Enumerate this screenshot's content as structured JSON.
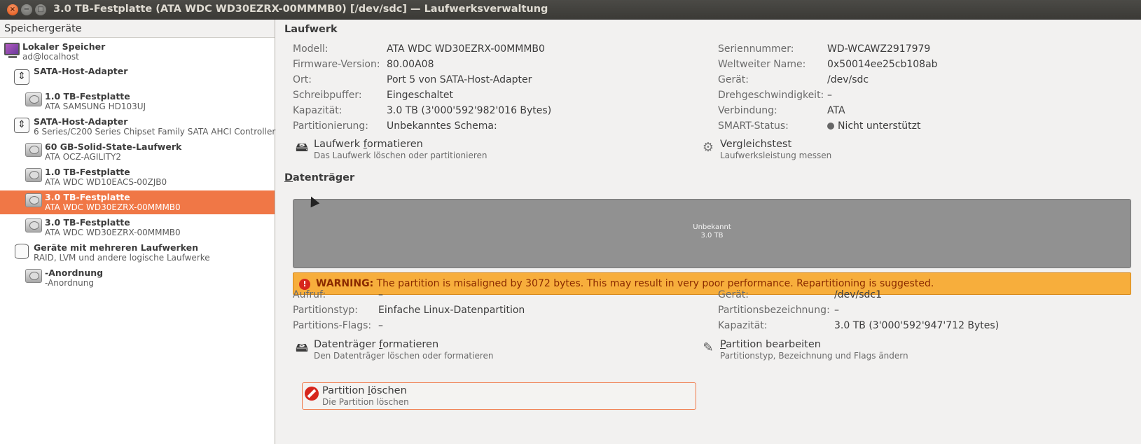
{
  "window": {
    "title": "3.0 TB-Festplatte (ATA WDC WD30EZRX-00MMMB0) [/dev/sdc] — Laufwerksverwaltung",
    "close_glyph": "×",
    "min_glyph": "−",
    "max_glyph": "□"
  },
  "sidebar": {
    "header": "Speichergeräte",
    "items": [
      {
        "title": "Lokaler Speicher",
        "sub": "ad@localhost"
      },
      {
        "title": "SATA-Host-Adapter",
        "sub": ""
      },
      {
        "title": "1.0 TB-Festplatte",
        "sub": "ATA SAMSUNG HD103UJ"
      },
      {
        "title": "SATA-Host-Adapter",
        "sub": "6 Series/C200 Series Chipset Family SATA AHCI Controller"
      },
      {
        "title": "60 GB-Solid-State-Laufwerk",
        "sub": "ATA OCZ-AGILITY2"
      },
      {
        "title": "1.0 TB-Festplatte",
        "sub": "ATA WDC WD10EACS-00ZJB0"
      },
      {
        "title": "3.0 TB-Festplatte",
        "sub": "ATA WDC WD30EZRX-00MMMB0"
      },
      {
        "title": "3.0 TB-Festplatte",
        "sub": "ATA WDC WD30EZRX-00MMMB0"
      },
      {
        "title": "Geräte mit mehreren Laufwerken",
        "sub": "RAID, LVM und andere logische Laufwerke"
      },
      {
        "title": "-Anordnung",
        "sub": "-Anordnung"
      }
    ]
  },
  "drive": {
    "header": "Laufwerk",
    "left": [
      {
        "label": "Modell:",
        "value": "ATA WDC WD30EZRX-00MMMB0"
      },
      {
        "label": "Firmware-Version:",
        "value": "80.00A08"
      },
      {
        "label": "Ort:",
        "value": "Port 5 von SATA-Host-Adapter"
      },
      {
        "label": "Schreibpuffer:",
        "value": "Eingeschaltet"
      },
      {
        "label": "Kapazität:",
        "value": "3.0 TB (3'000'592'982'016 Bytes)"
      },
      {
        "label": "Partitionierung:",
        "value": "Unbekanntes Schema:"
      }
    ],
    "right": [
      {
        "label": "Seriennummer:",
        "value": "WD-WCAWZ2917979"
      },
      {
        "label": "Weltweiter Name:",
        "value": "0x50014ee25cb108ab"
      },
      {
        "label": "Gerät:",
        "value": "/dev/sdc"
      },
      {
        "label": "Drehgeschwindigkeit:",
        "value": "–"
      },
      {
        "label": "Verbindung:",
        "value": "ATA"
      },
      {
        "label": "SMART-Status:",
        "value": "Nicht unterstützt"
      }
    ],
    "format_action": {
      "title_pre": "Laufwerk ",
      "title_u": "f",
      "title_post": "ormatieren",
      "sub": "Das Laufwerk löschen oder partitionieren"
    },
    "benchmark_action": {
      "title": "Vergleichstest",
      "sub": "Laufwerksleistung messen"
    }
  },
  "volumes": {
    "header_u": "D",
    "header_rest": "atenträger",
    "bar_name": "Unbekannt",
    "bar_size": "3.0 TB",
    "warning_prefix": "WARNING:",
    "warning_text": " The partition is misaligned by 3072 bytes. This may result in very poor performance. Repartitioning is suggested.",
    "left": [
      {
        "label": "Aufruf:",
        "value": "–"
      },
      {
        "label": "Partitionstyp:",
        "value": "Einfache Linux-Datenpartition"
      },
      {
        "label": "Partitions-Flags:",
        "value": "–"
      }
    ],
    "right": [
      {
        "label": "Gerät:",
        "value": "/dev/sdc1"
      },
      {
        "label": "Partitionsbezeichnung:",
        "value": "–"
      },
      {
        "label": "Kapazität:",
        "value": "3.0 TB (3'000'592'947'712 Bytes)"
      }
    ],
    "format_action": {
      "title_pre": "Datenträger ",
      "title_u": "f",
      "title_post": "ormatieren",
      "sub": "Den Datenträger löschen oder formatieren"
    },
    "edit_action": {
      "title_u": "P",
      "title_post": "artition bearbeiten",
      "sub": "Partitionstyp, Bezeichnung und Flags ändern"
    },
    "delete_action": {
      "title_pre": "Partition ",
      "title_u": "l",
      "title_post": "öschen",
      "sub": "Die Partition löschen"
    }
  }
}
